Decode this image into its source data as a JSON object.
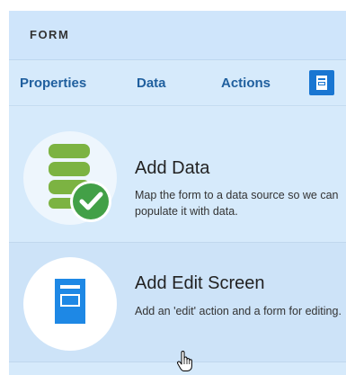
{
  "header": {
    "title": "FORM"
  },
  "tabs": [
    {
      "label": "Properties"
    },
    {
      "label": "Data"
    },
    {
      "label": "Actions"
    }
  ],
  "tab_icon": "form-layout-icon",
  "items": [
    {
      "title": "Add Data",
      "description": "Map the form to a data source so we can populate it with data.",
      "icon": "database-check-icon"
    },
    {
      "title": "Add Edit Screen",
      "description": "Add an 'edit' action and a form for editing.",
      "icon": "document-icon"
    }
  ],
  "colors": {
    "accent": "#1976d2",
    "tab_text": "#1f5f9e",
    "database_green": "#7cb342",
    "check_green": "#43a047",
    "document_blue": "#1e88e5"
  },
  "cursor": "hand-pointer-icon"
}
